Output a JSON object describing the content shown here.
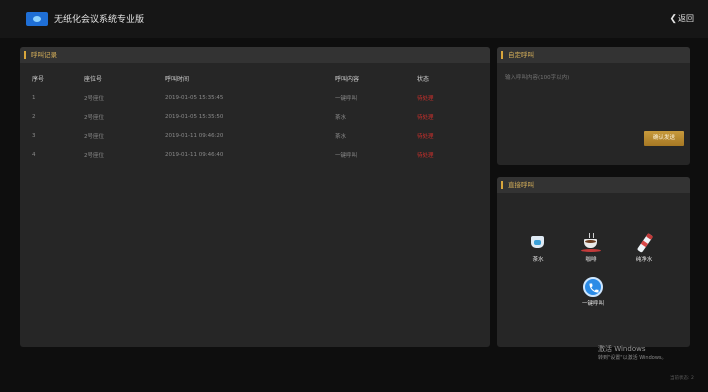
{
  "app": {
    "title": "无纸化会议系统专业版",
    "back_label": "返回"
  },
  "records": {
    "title": "呼叫记录",
    "columns": [
      "序号",
      "座位号",
      "呼叫时间",
      "呼叫内容",
      "状态"
    ],
    "rows": [
      [
        "1",
        "2号座位",
        "2019-01-05 15:35:45",
        "一键呼叫",
        "待处理"
      ],
      [
        "2",
        "2号座位",
        "2019-01-05 15:35:50",
        "茶水",
        "待处理"
      ],
      [
        "3",
        "2号座位",
        "2019-01-11 09:46:20",
        "茶水",
        "待处理"
      ],
      [
        "4",
        "2号座位",
        "2019-01-11 09:46:40",
        "一键呼叫",
        "待处理"
      ]
    ]
  },
  "custom": {
    "title": "自定呼叫",
    "placeholder": "输入呼叫内容(100字以内)",
    "send_label": "确认发送"
  },
  "quick": {
    "title": "直接呼叫",
    "items": [
      {
        "label": "茶水",
        "icon": "tea-cup-icon"
      },
      {
        "label": "咖啡",
        "icon": "coffee-icon"
      },
      {
        "label": "纯净水",
        "icon": "water-bottle-icon"
      },
      {
        "label": "一键呼叫",
        "icon": "phone-call-icon"
      }
    ]
  },
  "watermark": {
    "line1": "激活 Windows",
    "line2": "转到\"设置\"以激活 Windows。"
  },
  "corner_text": "当前状态: 2",
  "colors": {
    "accent": "#d9a63c",
    "status": "#c8302c",
    "call": "#2b8be6"
  }
}
